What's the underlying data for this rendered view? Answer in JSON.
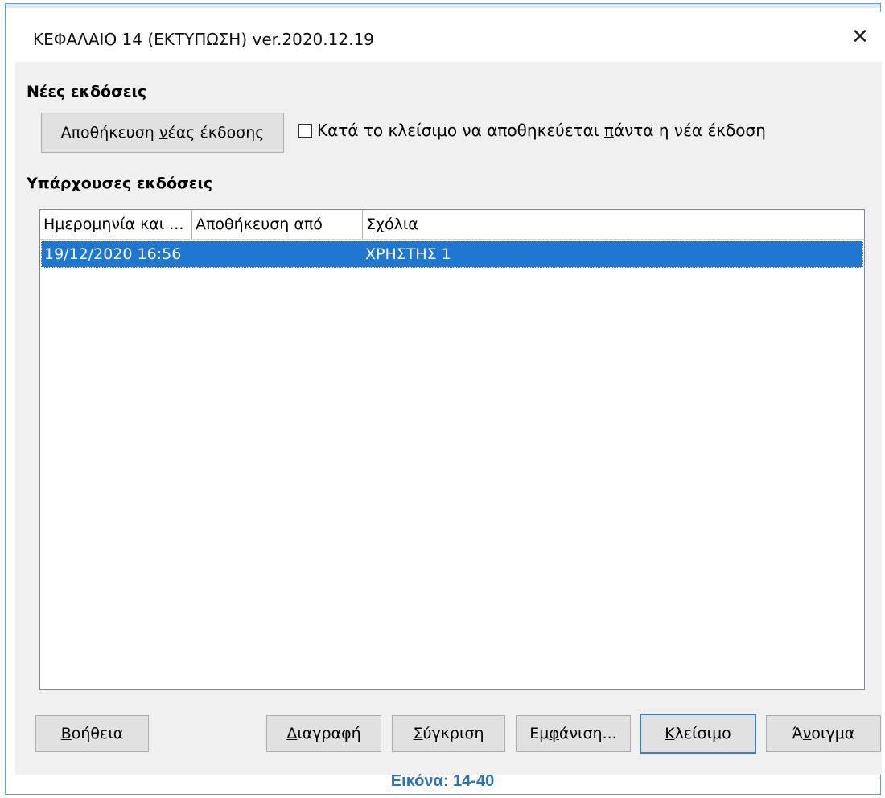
{
  "window": {
    "title": "ΚΕΦΑΛΑΙΟ 14 (ΕΚΤΥΠΩΣΗ) ver.2020.12.19",
    "close_symbol": "✕"
  },
  "new_versions": {
    "heading": "Νέες εκδόσεις",
    "save_button": {
      "before": "Αποθήκευση ",
      "mnemonic": "ν",
      "after": "έας έκδοσης"
    },
    "checkbox": {
      "before": "Κατά το κλείσιμο να αποθηκεύεται ",
      "mnemonic": "π",
      "after": "άντα η νέα έκδοση",
      "checked": false
    }
  },
  "existing_versions": {
    "heading": "Υπάρχουσες εκδόσεις",
    "columns": [
      "Ημερομηνία και ...",
      "Αποθήκευση από",
      "Σχόλια"
    ],
    "rows": [
      {
        "date": "19/12/2020 16:56",
        "saved_by": "",
        "comment": "ΧΡΗΣΤΗΣ 1",
        "selected": true
      }
    ]
  },
  "buttons": {
    "help": {
      "mnemonic": "Β",
      "rest": "οήθεια"
    },
    "delete": {
      "mnemonic": "Δ",
      "rest": "ιαγραφή"
    },
    "compare": {
      "mnemonic": "Σ",
      "rest": "ύγκριση"
    },
    "show": {
      "before": "Εμ",
      "mnemonic": "φ",
      "after": "άνιση..."
    },
    "close": {
      "mnemonic": "Κ",
      "rest": "λείσιμο"
    },
    "open": {
      "before": "Ά",
      "mnemonic": "ν",
      "after": "οιγμα"
    }
  },
  "caption": "Εικόνα: 14-40",
  "colors": {
    "selection": "#1f77d1",
    "caption": "#2e74b5",
    "default_button_border": "#3d7bc9"
  }
}
